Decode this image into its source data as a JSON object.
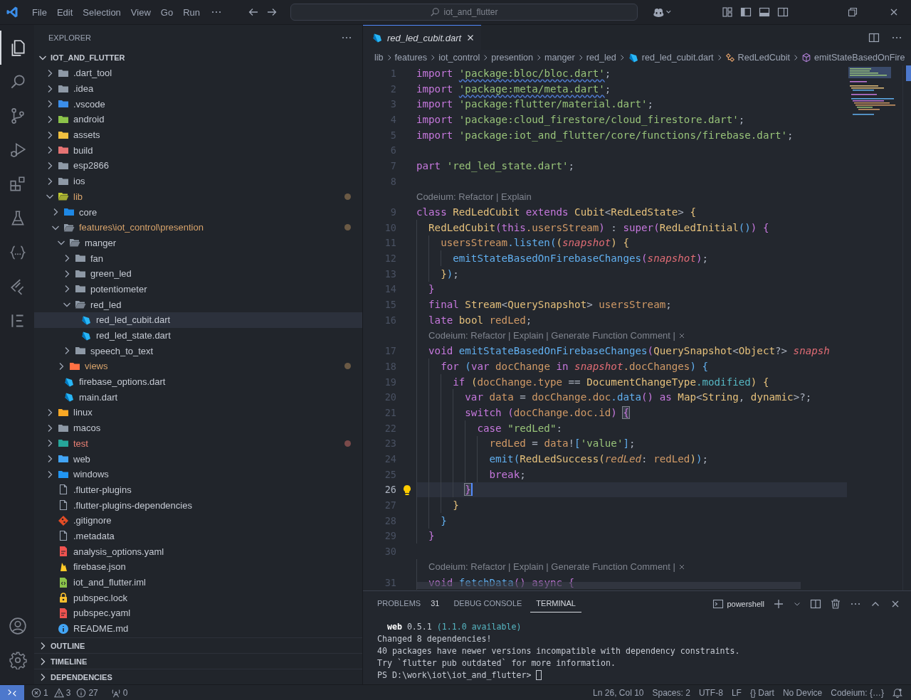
{
  "title_bar": {
    "menu": [
      "File",
      "Edit",
      "Selection",
      "View",
      "Go",
      "Run"
    ],
    "search": "iot_and_flutter"
  },
  "activity_bar": {
    "top": [
      {
        "kind": "explorer",
        "selected": true
      },
      {
        "kind": "search",
        "selected": false
      },
      {
        "kind": "source-control",
        "selected": false
      },
      {
        "kind": "run-debug",
        "selected": false
      },
      {
        "kind": "extensions",
        "selected": false
      },
      {
        "kind": "testing",
        "selected": false
      },
      {
        "kind": "braces",
        "selected": false
      },
      {
        "kind": "flutter",
        "selected": false
      },
      {
        "kind": "outline",
        "selected": false
      }
    ],
    "bottom": [
      {
        "kind": "account",
        "selected": false
      },
      {
        "kind": "settings",
        "selected": false
      }
    ]
  },
  "explorer": {
    "title": "EXPLORER",
    "root": {
      "label": "IOT_AND_FLUTTER",
      "expanded": true
    },
    "tree": [
      {
        "label": ".dart_tool",
        "kind": "folder",
        "expanded": false,
        "selected": false,
        "modified": false,
        "problems": false
      },
      {
        "label": ".idea",
        "kind": "folder-idea",
        "expanded": false,
        "selected": false,
        "modified": false,
        "problems": false
      },
      {
        "label": ".vscode",
        "kind": "folder-vscode",
        "expanded": false,
        "selected": false,
        "modified": false,
        "problems": false
      },
      {
        "label": "android",
        "kind": "folder-android",
        "expanded": false,
        "selected": false,
        "modified": false,
        "problems": false
      },
      {
        "label": "assets",
        "kind": "folder-assets",
        "expanded": false,
        "selected": false,
        "modified": false,
        "problems": false
      },
      {
        "label": "build",
        "kind": "folder-build",
        "expanded": false,
        "selected": false,
        "modified": false,
        "problems": false
      },
      {
        "label": "esp2866",
        "kind": "folder",
        "expanded": false,
        "selected": false,
        "modified": false,
        "problems": false
      },
      {
        "label": "ios",
        "kind": "folder-ios",
        "expanded": false,
        "selected": false,
        "modified": false,
        "problems": false
      },
      {
        "label": "lib",
        "kind": "folder-lib",
        "expanded": true,
        "selected": false,
        "modified": true,
        "problems": false,
        "children": [
          {
            "label": "core",
            "kind": "folder-core",
            "expanded": false,
            "selected": false,
            "modified": false,
            "problems": false
          },
          {
            "label": "features\\iot_control\\presention",
            "kind": "folder",
            "expanded": true,
            "selected": false,
            "modified": true,
            "problems": false,
            "children": [
              {
                "label": "manger",
                "kind": "folder",
                "expanded": true,
                "selected": false,
                "modified": false,
                "problems": false,
                "children": [
                  {
                    "label": "fan",
                    "kind": "folder",
                    "expanded": false,
                    "selected": false,
                    "modified": false,
                    "problems": false
                  },
                  {
                    "label": "green_led",
                    "kind": "folder",
                    "expanded": false,
                    "selected": false,
                    "modified": false,
                    "problems": false
                  },
                  {
                    "label": "potentiometer",
                    "kind": "folder",
                    "expanded": false,
                    "selected": false,
                    "modified": false,
                    "problems": false
                  },
                  {
                    "label": "red_led",
                    "kind": "folder",
                    "expanded": true,
                    "selected": false,
                    "modified": false,
                    "problems": false,
                    "children": [
                      {
                        "label": "red_led_cubit.dart",
                        "kind": "dart",
                        "selected": true,
                        "modified": false,
                        "problems": false
                      },
                      {
                        "label": "red_led_state.dart",
                        "kind": "dart",
                        "selected": false,
                        "modified": false,
                        "problems": false
                      }
                    ]
                  },
                  {
                    "label": "speech_to_text",
                    "kind": "folder",
                    "expanded": false,
                    "selected": false,
                    "modified": false,
                    "problems": false
                  }
                ]
              },
              {
                "label": "views",
                "kind": "folder-views",
                "expanded": false,
                "selected": false,
                "modified": true,
                "problems": false
              }
            ]
          },
          {
            "label": "firebase_options.dart",
            "kind": "dart",
            "selected": false,
            "modified": false,
            "problems": false
          },
          {
            "label": "main.dart",
            "kind": "dart",
            "selected": false,
            "modified": false,
            "problems": false
          }
        ]
      },
      {
        "label": "linux",
        "kind": "folder-linux",
        "expanded": false,
        "selected": false,
        "modified": false,
        "problems": false
      },
      {
        "label": "macos",
        "kind": "folder-macos",
        "expanded": false,
        "selected": false,
        "modified": false,
        "problems": false
      },
      {
        "label": "test",
        "kind": "folder-test",
        "expanded": false,
        "selected": false,
        "modified": true,
        "problems": true
      },
      {
        "label": "web",
        "kind": "folder-web",
        "expanded": false,
        "selected": false,
        "modified": false,
        "problems": false
      },
      {
        "label": "windows",
        "kind": "folder-windows",
        "expanded": false,
        "selected": false,
        "modified": false,
        "problems": false
      },
      {
        "label": ".flutter-plugins",
        "kind": "file",
        "selected": false,
        "modified": false,
        "problems": false
      },
      {
        "label": ".flutter-plugins-dependencies",
        "kind": "file",
        "selected": false,
        "modified": false,
        "problems": false
      },
      {
        "label": ".gitignore",
        "kind": "git",
        "selected": false,
        "modified": false,
        "problems": false
      },
      {
        "label": ".metadata",
        "kind": "file",
        "selected": false,
        "modified": false,
        "problems": false
      },
      {
        "label": "analysis_options.yaml",
        "kind": "yaml",
        "selected": false,
        "modified": false,
        "problems": false
      },
      {
        "label": "firebase.json",
        "kind": "firebase",
        "selected": false,
        "modified": false,
        "problems": false
      },
      {
        "label": "iot_and_flutter.iml",
        "kind": "xml",
        "selected": false,
        "modified": false,
        "problems": false
      },
      {
        "label": "pubspec.lock",
        "kind": "lock",
        "selected": false,
        "modified": false,
        "problems": false
      },
      {
        "label": "pubspec.yaml",
        "kind": "yaml",
        "selected": false,
        "modified": false,
        "problems": false
      },
      {
        "label": "README.md",
        "kind": "info",
        "selected": false,
        "modified": false,
        "problems": false
      }
    ],
    "sections": [
      {
        "label": "OUTLINE",
        "expanded": false
      },
      {
        "label": "TIMELINE",
        "expanded": false
      },
      {
        "label": "DEPENDENCIES",
        "expanded": false
      }
    ]
  },
  "editor": {
    "tabs": [
      {
        "label": "red_led_cubit.dart",
        "selected": true,
        "preview": true
      }
    ],
    "breadcrumbs": [
      {
        "label": "lib",
        "kind": "folder"
      },
      {
        "label": "features",
        "kind": "folder"
      },
      {
        "label": "iot_control",
        "kind": "folder"
      },
      {
        "label": "presention",
        "kind": "folder"
      },
      {
        "label": "manger",
        "kind": "folder"
      },
      {
        "label": "red_led",
        "kind": "folder"
      },
      {
        "label": "red_led_cubit.dart",
        "kind": "dart"
      },
      {
        "label": "RedLedCubit",
        "kind": "class"
      },
      {
        "label": "emitStateBasedOnFire",
        "kind": "method"
      }
    ],
    "lines": [
      {
        "kind": "code",
        "number": "1",
        "current": false,
        "lightbulb": false,
        "tokens": [
          {
            "text": "import ",
            "kind": "kw"
          },
          {
            "text": "'package:bloc/bloc.dart'",
            "kind": "strw"
          },
          {
            "text": ";",
            "kind": "p"
          }
        ]
      },
      {
        "kind": "code",
        "number": "2",
        "current": false,
        "lightbulb": false,
        "tokens": [
          {
            "text": "import ",
            "kind": "kw"
          },
          {
            "text": "'package:meta/meta.dart'",
            "kind": "strw"
          },
          {
            "text": ";",
            "kind": "p"
          }
        ]
      },
      {
        "kind": "code",
        "number": "3",
        "current": false,
        "lightbulb": false,
        "tokens": [
          {
            "text": "import ",
            "kind": "kw"
          },
          {
            "text": "'package:flutter/material.dart'",
            "kind": "str"
          },
          {
            "text": ";",
            "kind": "p"
          }
        ]
      },
      {
        "kind": "code",
        "number": "4",
        "current": false,
        "lightbulb": false,
        "tokens": [
          {
            "text": "import ",
            "kind": "kw"
          },
          {
            "text": "'package:cloud_firestore/cloud_firestore.dart'",
            "kind": "str"
          },
          {
            "text": ";",
            "kind": "p"
          }
        ]
      },
      {
        "kind": "code",
        "number": "5",
        "current": false,
        "lightbulb": false,
        "tokens": [
          {
            "text": "import ",
            "kind": "kw"
          },
          {
            "text": "'package:iot_and_flutter/core/functions/firebase.dart'",
            "kind": "str"
          },
          {
            "text": ";",
            "kind": "p"
          }
        ]
      },
      {
        "kind": "code",
        "number": "6",
        "current": false,
        "lightbulb": false
      },
      {
        "kind": "code",
        "number": "7",
        "current": false,
        "lightbulb": false,
        "tokens": [
          {
            "text": "part ",
            "kind": "kw"
          },
          {
            "text": "'red_led_state.dart'",
            "kind": "str"
          },
          {
            "text": ";",
            "kind": "p"
          }
        ]
      },
      {
        "kind": "code",
        "number": "8",
        "current": false,
        "lightbulb": false
      },
      {
        "kind": "codelens",
        "text": "Codeium: Refactor | Explain",
        "closable": false
      },
      {
        "kind": "code",
        "number": "9",
        "current": false,
        "lightbulb": false,
        "tokens": [
          {
            "text": "class ",
            "kind": "kw"
          },
          {
            "text": "RedLedCubit ",
            "kind": "type"
          },
          {
            "text": "extends ",
            "kind": "kw"
          },
          {
            "text": "Cubit",
            "kind": "type"
          },
          {
            "text": "<",
            "kind": "p"
          },
          {
            "text": "RedLedState",
            "kind": "type"
          },
          {
            "text": "> ",
            "kind": "p"
          },
          {
            "text": "{",
            "kind": "b1"
          }
        ]
      },
      {
        "kind": "code",
        "number": "10",
        "current": false,
        "lightbulb": false,
        "tokens": [
          {
            "text": "  RedLedCubit",
            "kind": "type"
          },
          {
            "text": "(",
            "kind": "b2"
          },
          {
            "text": "this",
            "kind": "kw"
          },
          {
            "text": ".usersStream",
            "kind": "field"
          },
          {
            "text": ")",
            "kind": "b2"
          },
          {
            "text": " : ",
            "kind": "p"
          },
          {
            "text": "super",
            "kind": "kw"
          },
          {
            "text": "(",
            "kind": "b2"
          },
          {
            "text": "RedLedInitial",
            "kind": "type"
          },
          {
            "text": "()",
            "kind": "b3"
          },
          {
            "text": ")",
            "kind": "b2"
          },
          {
            "text": " {",
            "kind": "b2"
          }
        ]
      },
      {
        "kind": "code",
        "number": "11",
        "current": false,
        "lightbulb": false,
        "tokens": [
          {
            "text": "    usersStream",
            "kind": "field"
          },
          {
            "text": ".listen",
            "kind": "fn"
          },
          {
            "text": "(",
            "kind": "b3"
          },
          {
            "text": "(",
            "kind": "b1"
          },
          {
            "text": "snapshot",
            "kind": "param"
          },
          {
            "text": ")",
            "kind": "b1"
          },
          {
            "text": " {",
            "kind": "b1"
          }
        ]
      },
      {
        "kind": "code",
        "number": "12",
        "current": false,
        "lightbulb": false,
        "tokens": [
          {
            "text": "      emitStateBasedOnFirebaseChanges",
            "kind": "fn"
          },
          {
            "text": "(",
            "kind": "b2"
          },
          {
            "text": "snapshot",
            "kind": "param"
          },
          {
            "text": ")",
            "kind": "b2"
          },
          {
            "text": ";",
            "kind": "p"
          }
        ]
      },
      {
        "kind": "code",
        "number": "13",
        "current": false,
        "lightbulb": false,
        "tokens": [
          {
            "text": "    }",
            "kind": "b1"
          },
          {
            "text": ")",
            "kind": "b3"
          },
          {
            "text": ";",
            "kind": "p"
          }
        ]
      },
      {
        "kind": "code",
        "number": "14",
        "current": false,
        "lightbulb": false,
        "tokens": [
          {
            "text": "  }",
            "kind": "b2"
          }
        ]
      },
      {
        "kind": "code",
        "number": "15",
        "current": false,
        "lightbulb": false,
        "tokens": [
          {
            "text": "  final ",
            "kind": "kw"
          },
          {
            "text": "Stream",
            "kind": "type"
          },
          {
            "text": "<",
            "kind": "p"
          },
          {
            "text": "QuerySnapshot",
            "kind": "type"
          },
          {
            "text": "> ",
            "kind": "p"
          },
          {
            "text": "usersStream",
            "kind": "field"
          },
          {
            "text": ";",
            "kind": "p"
          }
        ]
      },
      {
        "kind": "code",
        "number": "16",
        "current": false,
        "lightbulb": false,
        "tokens": [
          {
            "text": "  late ",
            "kind": "kw"
          },
          {
            "text": "bool ",
            "kind": "type"
          },
          {
            "text": "redLed",
            "kind": "field"
          },
          {
            "text": ";",
            "kind": "p"
          }
        ]
      },
      {
        "kind": "codelens",
        "text": "Codeium: Refactor | Explain | Generate Function Comment |",
        "closable": true
      },
      {
        "kind": "code",
        "number": "17",
        "current": false,
        "lightbulb": false,
        "tokens": [
          {
            "text": "  void ",
            "kind": "kw"
          },
          {
            "text": "emitStateBasedOnFirebaseChanges",
            "kind": "fn"
          },
          {
            "text": "(",
            "kind": "b2"
          },
          {
            "text": "QuerySnapshot",
            "kind": "type"
          },
          {
            "text": "<",
            "kind": "p"
          },
          {
            "text": "Object",
            "kind": "type"
          },
          {
            "text": "?> ",
            "kind": "p"
          },
          {
            "text": "snapsh",
            "kind": "param"
          }
        ]
      },
      {
        "kind": "code",
        "number": "18",
        "current": false,
        "lightbulb": false,
        "tokens": [
          {
            "text": "    for ",
            "kind": "kw"
          },
          {
            "text": "(",
            "kind": "b3"
          },
          {
            "text": "var",
            "kind": "kw"
          },
          {
            "text": " docChange ",
            "kind": "field"
          },
          {
            "text": "in ",
            "kind": "kw"
          },
          {
            "text": "snapshot",
            "kind": "param"
          },
          {
            "text": ".docChanges",
            "kind": "field"
          },
          {
            "text": ")",
            "kind": "b3"
          },
          {
            "text": " {",
            "kind": "b3"
          }
        ]
      },
      {
        "kind": "code",
        "number": "19",
        "current": false,
        "lightbulb": false,
        "tokens": [
          {
            "text": "      if ",
            "kind": "kw"
          },
          {
            "text": "(",
            "kind": "b1"
          },
          {
            "text": "docChange.type",
            "kind": "field"
          },
          {
            "text": " == ",
            "kind": "p"
          },
          {
            "text": "DocumentChangeType",
            "kind": "type"
          },
          {
            "text": ".modified",
            "kind": "cyan"
          },
          {
            "text": ")",
            "kind": "b1"
          },
          {
            "text": " {",
            "kind": "b1"
          }
        ]
      },
      {
        "kind": "code",
        "number": "20",
        "current": false,
        "lightbulb": false,
        "tokens": [
          {
            "text": "        var",
            "kind": "kw"
          },
          {
            "text": " data",
            "kind": "field"
          },
          {
            "text": " = ",
            "kind": "p"
          },
          {
            "text": "docChange.doc",
            "kind": "field"
          },
          {
            "text": ".data",
            "kind": "fn"
          },
          {
            "text": "()",
            "kind": "b2"
          },
          {
            "text": " as ",
            "kind": "kw"
          },
          {
            "text": "Map",
            "kind": "type"
          },
          {
            "text": "<",
            "kind": "p"
          },
          {
            "text": "String",
            "kind": "type"
          },
          {
            "text": ", ",
            "kind": "p"
          },
          {
            "text": "dynamic",
            "kind": "type"
          },
          {
            "text": ">?;",
            "kind": "p"
          }
        ]
      },
      {
        "kind": "code",
        "number": "21",
        "current": false,
        "lightbulb": false,
        "tokens": [
          {
            "text": "        switch ",
            "kind": "kw"
          },
          {
            "text": "(",
            "kind": "b2"
          },
          {
            "text": "docChange.doc.id",
            "kind": "field"
          },
          {
            "text": ") ",
            "kind": "b2"
          },
          {
            "text": "{",
            "kind": "bm"
          }
        ]
      },
      {
        "kind": "code",
        "number": "22",
        "current": false,
        "lightbulb": false,
        "tokens": [
          {
            "text": "          case ",
            "kind": "kw"
          },
          {
            "text": "\"redLed\"",
            "kind": "str"
          },
          {
            "text": ":",
            "kind": "p"
          }
        ]
      },
      {
        "kind": "code",
        "number": "23",
        "current": false,
        "lightbulb": false,
        "tokens": [
          {
            "text": "            redLed",
            "kind": "field"
          },
          {
            "text": " = ",
            "kind": "p"
          },
          {
            "text": "data",
            "kind": "field"
          },
          {
            "text": "!",
            "kind": "p"
          },
          {
            "text": "[",
            "kind": "b3"
          },
          {
            "text": "'value'",
            "kind": "str"
          },
          {
            "text": "]",
            "kind": "b3"
          },
          {
            "text": ";",
            "kind": "p"
          }
        ]
      },
      {
        "kind": "code",
        "number": "24",
        "current": false,
        "lightbulb": false,
        "tokens": [
          {
            "text": "            emit",
            "kind": "fn"
          },
          {
            "text": "(",
            "kind": "b3"
          },
          {
            "text": "RedLedSuccess",
            "kind": "type"
          },
          {
            "text": "(",
            "kind": "b1"
          },
          {
            "text": "redLed",
            "kind": "named"
          },
          {
            "text": ": ",
            "kind": "p"
          },
          {
            "text": "redLed",
            "kind": "field"
          },
          {
            "text": ")",
            "kind": "b1"
          },
          {
            "text": ")",
            "kind": "b3"
          },
          {
            "text": ";",
            "kind": "p"
          }
        ]
      },
      {
        "kind": "code",
        "number": "25",
        "current": false,
        "lightbulb": false,
        "tokens": [
          {
            "text": "            break",
            "kind": "kw"
          },
          {
            "text": ";",
            "kind": "p"
          }
        ]
      },
      {
        "kind": "code",
        "number": "26",
        "current": true,
        "lightbulb": true,
        "tokens": [
          {
            "text": "        }",
            "kind": "bm"
          }
        ]
      },
      {
        "kind": "code",
        "number": "27",
        "current": false,
        "lightbulb": false,
        "tokens": [
          {
            "text": "      }",
            "kind": "b1"
          }
        ]
      },
      {
        "kind": "code",
        "number": "28",
        "current": false,
        "lightbulb": false,
        "tokens": [
          {
            "text": "    }",
            "kind": "b3"
          }
        ]
      },
      {
        "kind": "code",
        "number": "29",
        "current": false,
        "lightbulb": false,
        "tokens": [
          {
            "text": "  }",
            "kind": "b2"
          }
        ]
      },
      {
        "kind": "code",
        "number": "30",
        "current": false,
        "lightbulb": false
      },
      {
        "kind": "codelens",
        "text": "Codeium: Refactor | Explain | Generate Function Comment |",
        "closable": true
      },
      {
        "kind": "code",
        "number": "31",
        "current": false,
        "lightbulb": false,
        "tokens": [
          {
            "text": "  void ",
            "kind": "kw"
          },
          {
            "text": "fetchData",
            "kind": "fn"
          },
          {
            "text": "()",
            "kind": "b2"
          },
          {
            "text": " async",
            "kind": "kw"
          },
          {
            "text": " {",
            "kind": "b2"
          }
        ]
      }
    ]
  },
  "panel": {
    "tabs": [
      {
        "label": "PROBLEMS",
        "count": "31",
        "selected": false
      },
      {
        "label": "DEBUG CONSOLE",
        "selected": false
      },
      {
        "label": "TERMINAL",
        "selected": true
      }
    ],
    "shell": "powershell",
    "terminal": [
      {
        "cursor": false,
        "tokens": [
          {
            "text": "  web",
            "kind": "bold"
          },
          {
            "text": " 0.5.1 ",
            "kind": "p"
          },
          {
            "text": "(1.1.0 available)",
            "kind": "cyan"
          }
        ]
      },
      {
        "cursor": false,
        "tokens": [
          {
            "text": "Changed 8 dependencies!",
            "kind": "p"
          }
        ]
      },
      {
        "cursor": false,
        "tokens": [
          {
            "text": "40 packages have newer versions incompatible with dependency constraints.",
            "kind": "p"
          }
        ]
      },
      {
        "cursor": false,
        "tokens": [
          {
            "text": "Try `flutter pub outdated` for more information.",
            "kind": "p"
          }
        ]
      },
      {
        "cursor": true,
        "tokens": [
          {
            "text": "PS D:\\work\\iot\\iot_and_flutter>",
            "kind": "p"
          }
        ]
      }
    ]
  },
  "status_bar": {
    "left": [
      {
        "kind": "errors",
        "text": "1"
      },
      {
        "kind": "warnings",
        "text": "3"
      },
      {
        "kind": "info",
        "text": "27"
      },
      {
        "kind": "ports",
        "text": "0"
      }
    ],
    "right": [
      "Ln 26, Col 10",
      "Spaces: 2",
      "UTF-8",
      "LF",
      "{} Dart",
      "No Device",
      "Codeium: {…}"
    ]
  }
}
